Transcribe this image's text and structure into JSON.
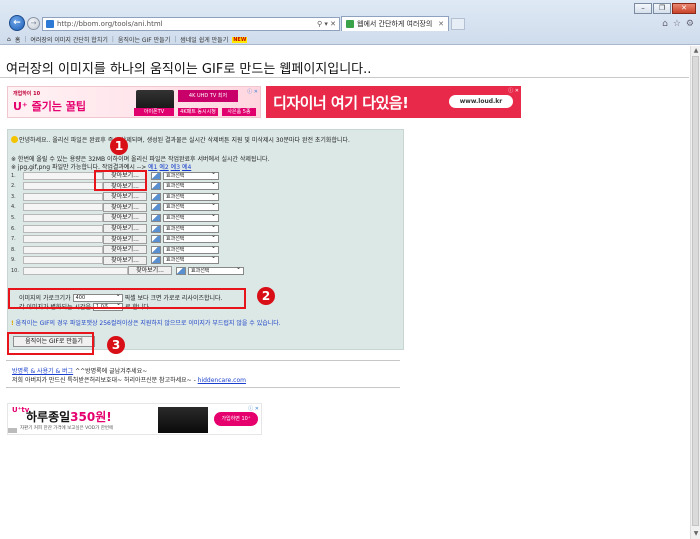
{
  "browser": {
    "url": "http://bbom.org/tools/ani.html",
    "address_tools": "⚲ ▾ ✕",
    "tab_title": "웹에서 간단하게 여러장의 ...",
    "tab_close": "✕",
    "favorites": [
      {
        "label": "홈"
      },
      {
        "label": "여러장의 이미지 간단히 합치기"
      },
      {
        "label": "움직이는 GIF 만들기"
      },
      {
        "label": "썸네일 쉽게 만들기",
        "badge": "NEW"
      }
    ]
  },
  "page": {
    "title": "여러장의 이미지를 하나의 움직이는 GIF로 만드는 웹페이지입니다..",
    "ads": {
      "top_left": {
        "brand": "개업하이 10",
        "slogan": "U⁺ 즐기는 꿀팁",
        "tv_box": "4K UHD TV 최저",
        "chip1": "아이폰TV",
        "chip2": "4K패트 동시시청",
        "chip3": "사은품 5종",
        "badge": "ⓘ ✕"
      },
      "top_right": {
        "text": "디자이너 여기 다있음!",
        "url": "www.loud.kr",
        "badge": "ⓘ ✕"
      },
      "bottom": {
        "logo": "U⁺tv",
        "headline_a": "하루종일",
        "headline_b": "350원!",
        "sub": "자판기 커피 한잔 가격에 보고싶은 VOD가 한번에",
        "pill": "가입하면 10⁺",
        "badge": "ⓘ ✕"
      }
    }
  },
  "tool": {
    "greeting": "안녕하세요.. 올리신 파일은 완료후 즉시 삭제되며, 생성된 결과물은 실시간 삭제버튼 지원 및 미삭제시 30분마다 완전 초기화합니다.",
    "note1": "※ 한번에 올릴 수 있는 용량은 32MB 이하이며 올리신 파일은 작업완료후 서버에서 실시간 삭제됩니다.",
    "note2": "※ jpg,gif,png 파일만 가능합니다. 작업결과예시 -->",
    "examples": [
      "예1",
      "예2",
      "예3",
      "예4"
    ],
    "browse_label": "찾아보기...",
    "effect_default": "효과선택",
    "rows": [
      "1.",
      "2.",
      "3.",
      "4.",
      "5.",
      "6.",
      "7.",
      "8.",
      "9.",
      "10."
    ],
    "width_prefix": "이미지의 가로크기가",
    "width_value": "400",
    "width_suffix": "픽셀 보다 크면 가로로 리사이즈합니다.",
    "time_prefix": "각 이미지가 변화되는 시간을",
    "time_value": "1.0초",
    "time_suffix": "로 합니다.",
    "warning": "움직이는 GIF의 경우 파일포맷상 256컬러이상은 지원하지 않으므로 이미지가 부드럽지 않을 수 있습니다.",
    "warning_mark": "!",
    "make_button": "움직이는 GIF로 만들기"
  },
  "callouts": [
    "1",
    "2",
    "3"
  ],
  "footer": {
    "line1_link": "방명록 & 사용기 & 버그",
    "line1_text": " ^^방명록에 글남겨주세요~",
    "line2_text": "저희 아버지가 만드신 특허받은허리보호대~ 허리아프신분 참고하세요~ - ",
    "line2_link": "hiddencare.com"
  },
  "window": {
    "min": "–",
    "max": "❐",
    "close": "✕"
  },
  "colors": {
    "callout": "#e8141b",
    "panel": "#dce8e6",
    "link": "#1a3fcc",
    "ad_pink": "#e5006e"
  }
}
